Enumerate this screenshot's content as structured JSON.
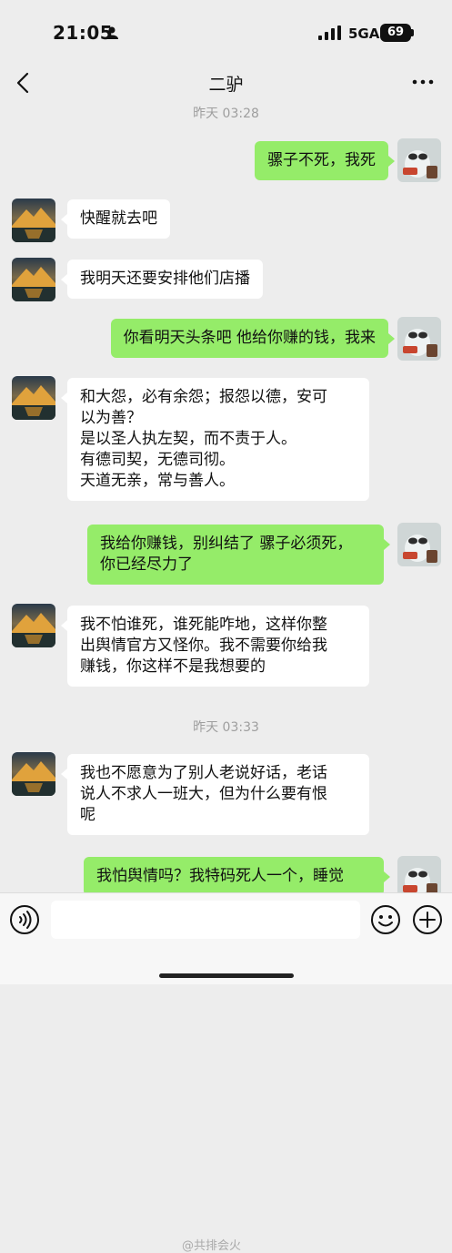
{
  "status": {
    "time": "21:05",
    "network": "5GA",
    "battery": "69"
  },
  "nav": {
    "title": "二驴"
  },
  "timestamps": [
    "昨天 03:28",
    "昨天 03:33"
  ],
  "messages": [
    {
      "lines": [
        "骡子不死，我死"
      ]
    },
    {
      "lines": [
        "快醒就去吧"
      ]
    },
    {
      "lines": [
        "我明天还要安排他们店播"
      ]
    },
    {
      "lines": [
        "你看明天头条吧 他给你赚的钱，我来"
      ]
    },
    {
      "lines": [
        "和大怨，必有余怨；报怨以德，安可",
        "以为善？",
        "是以圣人执左契，而不责于人。",
        "有德司契，无德司彻。",
        "天道无亲，常与善人。"
      ]
    },
    {
      "lines": [
        "我给你赚钱，别纠结了 骡子必须死，",
        "你已经尽力了"
      ]
    },
    {
      "lines": [
        "我不怕谁死，谁死能咋地，这样你整",
        "出舆情官方又怪你。我不需要你给我",
        "赚钱，你这样不是我想要的"
      ]
    },
    {
      "lines": [
        "我也不愿意为了别人老说好话，老话",
        "说人不求人一班大，但为什么要有恨",
        "呢"
      ]
    },
    {
      "lines": [
        "我怕舆情吗？我特码死人一个，睡觉"
      ]
    }
  ],
  "watermark": "@共排会火",
  "colors": {
    "outgoing": "#95ec69",
    "incoming": "#ffffff",
    "background": "#ededed"
  },
  "icons": [
    "person-icon",
    "signal-icon",
    "back-icon",
    "more-icon",
    "voice-icon",
    "emoji-icon",
    "plus-icon",
    "avatar-mountain",
    "avatar-cartoon"
  ]
}
